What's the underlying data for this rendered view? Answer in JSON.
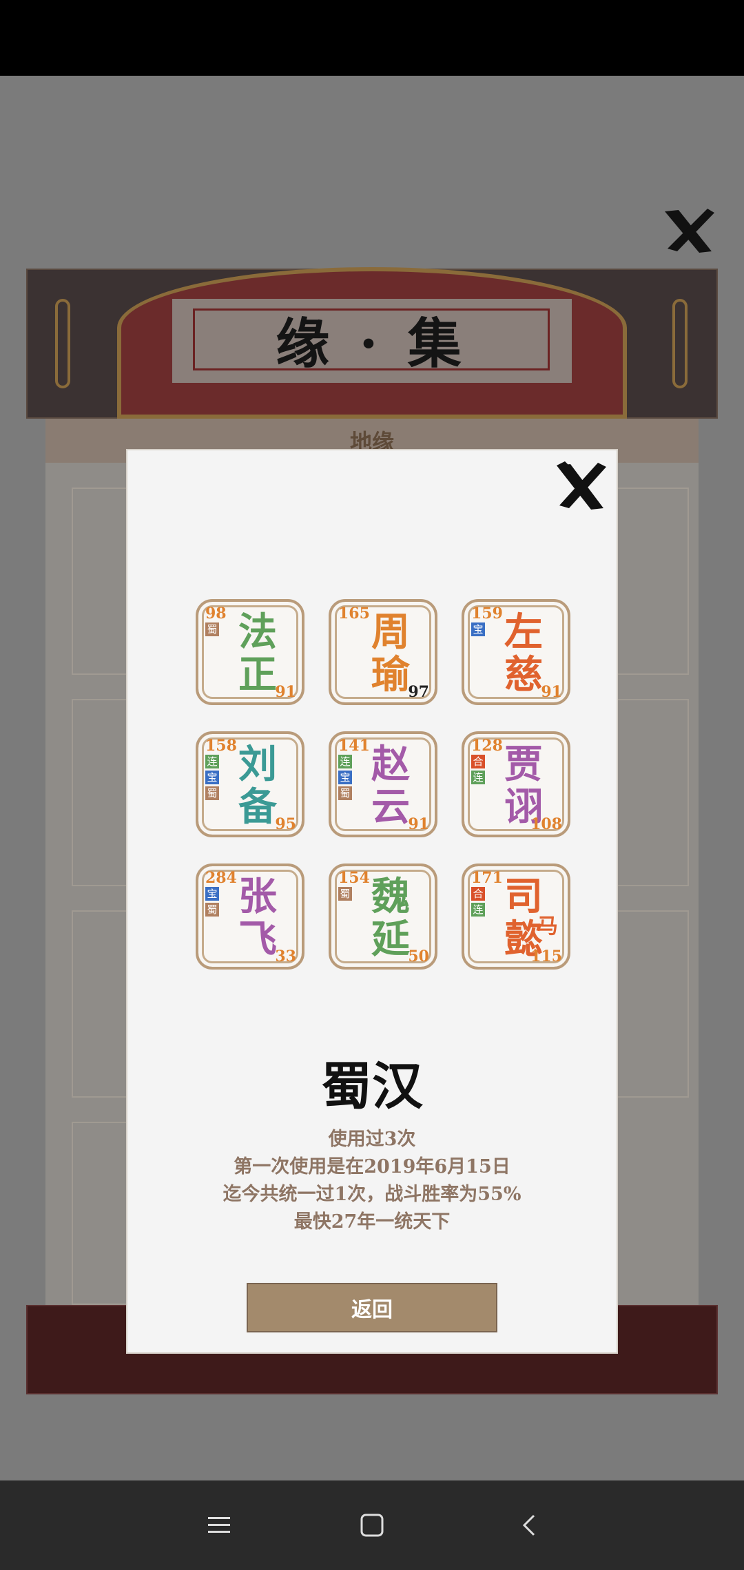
{
  "background": {
    "title": "缘 · 集",
    "tab_label": "地缘"
  },
  "heroes": [
    {
      "chars": [
        "法",
        "正"
      ],
      "top_num": "98",
      "bottom_num": "91",
      "color": "#5fa05a",
      "tags": [
        {
          "label": "蜀",
          "color": "#b08060"
        }
      ]
    },
    {
      "chars": [
        "周",
        "瑜"
      ],
      "top_num": "165",
      "bottom_num": "97",
      "color": "#e0822e",
      "bottom_dark": true,
      "tags": []
    },
    {
      "chars": [
        "左",
        "慈"
      ],
      "top_num": "159",
      "bottom_num": "91",
      "color": "#e0622e",
      "tags": [
        {
          "label": "宝",
          "color": "#3a6fc4"
        }
      ]
    },
    {
      "chars": [
        "刘",
        "备"
      ],
      "top_num": "158",
      "bottom_num": "95",
      "color": "#3b9a95",
      "tags": [
        {
          "label": "连",
          "color": "#5fa05a"
        },
        {
          "label": "宝",
          "color": "#3a6fc4"
        },
        {
          "label": "蜀",
          "color": "#b08060"
        }
      ]
    },
    {
      "chars": [
        "赵",
        "云"
      ],
      "top_num": "141",
      "bottom_num": "91",
      "color": "#a35aa8",
      "tags": [
        {
          "label": "连",
          "color": "#5fa05a"
        },
        {
          "label": "宝",
          "color": "#3a6fc4"
        },
        {
          "label": "蜀",
          "color": "#b08060"
        }
      ]
    },
    {
      "chars": [
        "贾",
        "诩"
      ],
      "top_num": "128",
      "bottom_num": "108",
      "color": "#a35aa8",
      "tags": [
        {
          "label": "合",
          "color": "#d9502a"
        },
        {
          "label": "连",
          "color": "#5fa05a"
        }
      ]
    },
    {
      "chars": [
        "张",
        "飞"
      ],
      "top_num": "284",
      "bottom_num": "33",
      "color": "#a35aa8",
      "tags": [
        {
          "label": "宝",
          "color": "#3a6fc4"
        },
        {
          "label": "蜀",
          "color": "#b08060"
        }
      ]
    },
    {
      "chars": [
        "魏",
        "延"
      ],
      "top_num": "154",
      "bottom_num": "50",
      "color": "#5fa05a",
      "tags": [
        {
          "label": "蜀",
          "color": "#b08060"
        }
      ]
    },
    {
      "chars": [
        "司",
        "懿"
      ],
      "suffix": "马",
      "top_num": "171",
      "bottom_num": "115",
      "color": "#e0622e",
      "tags": [
        {
          "label": "合",
          "color": "#d9502a"
        },
        {
          "label": "连",
          "color": "#5fa05a"
        }
      ]
    }
  ],
  "faction": {
    "name": "蜀汉",
    "stats": [
      "使用过3次",
      "第一次使用是在2019年6月15日",
      "迄今共统一过1次，战斗胜率为55%",
      "最快27年一统天下"
    ]
  },
  "return_label": "返回",
  "icons": {
    "close": "close-icon",
    "nav_menu": "menu-icon",
    "nav_home": "home-icon",
    "nav_back": "back-icon"
  }
}
